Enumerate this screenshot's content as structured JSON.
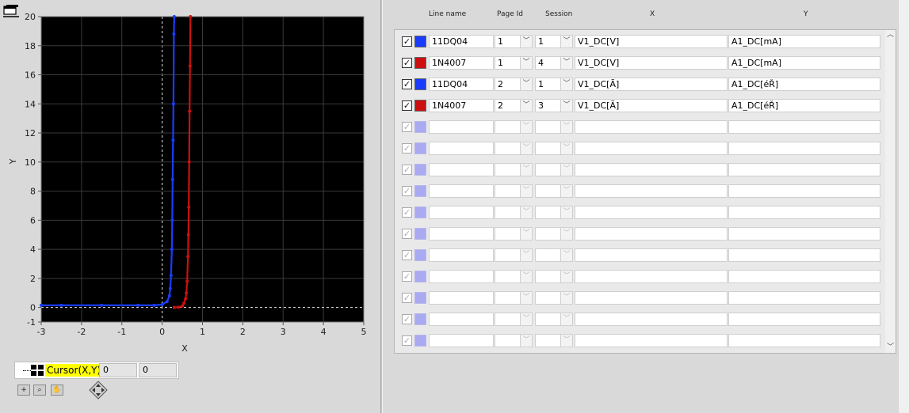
{
  "graph": {
    "x_axis_label": "X",
    "y_axis_label": "Y",
    "x_ticks": [
      "-3",
      "-2",
      "-1",
      "0",
      "1",
      "2",
      "3",
      "4",
      "5"
    ],
    "y_ticks": [
      "20",
      "18",
      "16",
      "14",
      "12",
      "10",
      "8",
      "6",
      "4",
      "2",
      "0",
      "-1"
    ]
  },
  "chart_data": {
    "type": "line",
    "xlabel": "X",
    "ylabel": "Y",
    "xlim": [
      -3,
      5
    ],
    "ylim": [
      -1,
      20
    ],
    "grid": true,
    "series": [
      {
        "name": "11DQ04",
        "color": "#1a3cff",
        "x": [
          -3,
          -2.5,
          -1.5,
          -0.6,
          -0.2,
          0.0,
          0.12,
          0.18,
          0.2,
          0.22,
          0.24,
          0.25,
          0.26,
          0.27,
          0.28,
          0.29,
          0.3
        ],
        "y": [
          0.15,
          0.15,
          0.15,
          0.15,
          0.15,
          0.2,
          0.4,
          0.8,
          1.3,
          2.2,
          4.0,
          6.0,
          8.8,
          11.5,
          14.0,
          18.8,
          20.0
        ]
      },
      {
        "name": "1N4007",
        "color": "#cc1010",
        "x": [
          0.3,
          0.4,
          0.5,
          0.54,
          0.58,
          0.6,
          0.62,
          0.64,
          0.65,
          0.66,
          0.67,
          0.68,
          0.69,
          0.7
        ],
        "y": [
          0.0,
          0.02,
          0.1,
          0.3,
          0.6,
          1.0,
          1.8,
          3.5,
          5.0,
          6.9,
          10.0,
          13.5,
          16.6,
          20.0
        ]
      }
    ]
  },
  "cursor": {
    "label": "Cursor(X,Y)",
    "x_value": "0",
    "y_value": "0"
  },
  "table": {
    "headers": {
      "line_name": "Line name",
      "page_id": "Page Id",
      "session": "Session",
      "x": "X",
      "y": "Y"
    },
    "rows": [
      {
        "checked": true,
        "color": "#1a3cff",
        "line_name": "11DQ04",
        "page_id": "1",
        "session": "1",
        "x": "V1_DC[V]",
        "y": "A1_DC[mA]"
      },
      {
        "checked": true,
        "color": "#cc1010",
        "line_name": "1N4007",
        "page_id": "1",
        "session": "4",
        "x": "V1_DC[V]",
        "y": "A1_DC[mA]"
      },
      {
        "checked": true,
        "color": "#1a3cff",
        "line_name": "11DQ04",
        "page_id": "2",
        "session": "1",
        "x": "V1_DC[Ã]",
        "y": "A1_DC[éŘ]"
      },
      {
        "checked": true,
        "color": "#cc1010",
        "line_name": "1N4007",
        "page_id": "2",
        "session": "3",
        "x": "V1_DC[Ã]",
        "y": "A1_DC[éŘ]"
      },
      {
        "checked": true,
        "color": "#a9aaf2",
        "line_name": "",
        "page_id": "",
        "session": "",
        "x": "",
        "y": ""
      },
      {
        "checked": true,
        "color": "#a9aaf2",
        "line_name": "",
        "page_id": "",
        "session": "",
        "x": "",
        "y": ""
      },
      {
        "checked": true,
        "color": "#a9aaf2",
        "line_name": "",
        "page_id": "",
        "session": "",
        "x": "",
        "y": ""
      },
      {
        "checked": true,
        "color": "#a9aaf2",
        "line_name": "",
        "page_id": "",
        "session": "",
        "x": "",
        "y": ""
      },
      {
        "checked": true,
        "color": "#a9aaf2",
        "line_name": "",
        "page_id": "",
        "session": "",
        "x": "",
        "y": ""
      },
      {
        "checked": true,
        "color": "#a9aaf2",
        "line_name": "",
        "page_id": "",
        "session": "",
        "x": "",
        "y": ""
      },
      {
        "checked": true,
        "color": "#a9aaf2",
        "line_name": "",
        "page_id": "",
        "session": "",
        "x": "",
        "y": ""
      },
      {
        "checked": true,
        "color": "#a9aaf2",
        "line_name": "",
        "page_id": "",
        "session": "",
        "x": "",
        "y": ""
      },
      {
        "checked": true,
        "color": "#a9aaf2",
        "line_name": "",
        "page_id": "",
        "session": "",
        "x": "",
        "y": ""
      },
      {
        "checked": true,
        "color": "#a9aaf2",
        "line_name": "",
        "page_id": "",
        "session": "",
        "x": "",
        "y": ""
      },
      {
        "checked": true,
        "color": "#a9aaf2",
        "line_name": "",
        "page_id": "",
        "session": "",
        "x": "",
        "y": ""
      }
    ]
  }
}
